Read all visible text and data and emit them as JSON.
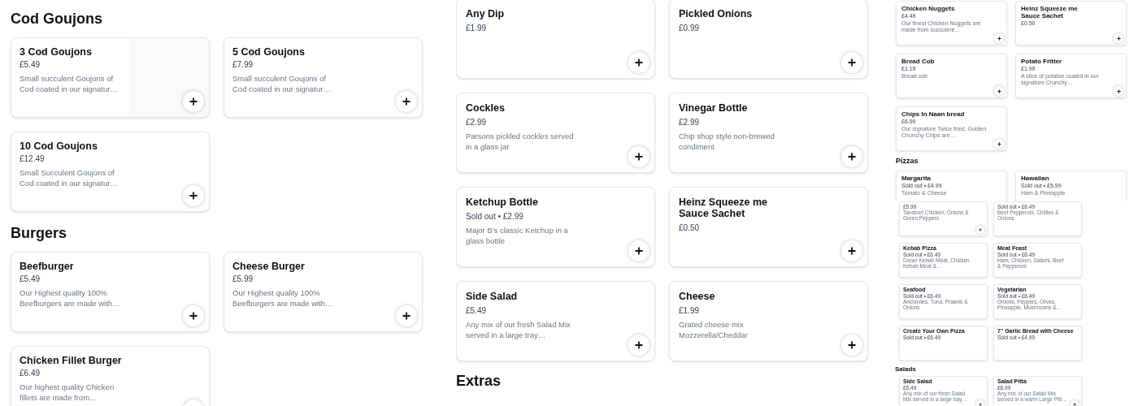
{
  "panels": [
    {
      "kind": "large",
      "sections": [
        {
          "heading": "Cod Goujons",
          "items": [
            {
              "name": "3 Cod Goujons",
              "price": "£5.49",
              "description": "Small succulent Goujons of Cod coated in our signatur…",
              "image": true,
              "add_button": true
            },
            {
              "name": "5 Cod Goujons",
              "price": "£7.99",
              "description": "Small succulent Goujons of Cod coated in our signatur…",
              "add_button": true
            },
            {
              "name": "10 Cod Goujons",
              "price": "£12.49",
              "description": "Small Succulent Goujons of Cod coated in our signatur…",
              "add_button": true
            }
          ]
        },
        {
          "heading": "Burgers",
          "items": [
            {
              "name": "Beefburger",
              "price": "£5.49",
              "description": "Our Highest quality 100% Beefburgers are made with…",
              "add_button": true
            },
            {
              "name": "Cheese Burger",
              "price": "£5.99",
              "description": "Our Highest quality 100% Beefburgers are made with…",
              "add_button": true
            },
            {
              "name": "Chicken Fillet Burger",
              "price": "£6.49",
              "description": "Our highest quality Chicken fillets are made from…",
              "add_button": true
            }
          ]
        }
      ]
    },
    {
      "kind": "large_cut",
      "sections": [
        {
          "items": [
            {
              "name": "Any Dip",
              "price": "£1.99",
              "add_button": true
            },
            {
              "name": "Pickled Onions",
              "price": "£0.99",
              "add_button": true
            },
            {
              "name": "Cockles",
              "price": "£2.99",
              "description": "Parsons pickled cockles served in a glass jar",
              "add_button": true
            },
            {
              "name": "Vinegar Bottle",
              "price": "£2.99",
              "description": "Chip shop style non-brewed condiment",
              "add_button": true
            },
            {
              "name": "Ketchup Bottle",
              "price": "Sold out • £2.99",
              "description": "Major B's classic Ketchup in a glass bottle",
              "add_button": true
            },
            {
              "name": "Heinz Squeeze me Sauce Sachet",
              "price": "£0.50",
              "add_button": true
            },
            {
              "name": "Side Salad",
              "price": "£5.49",
              "description": "Any mix of our fresh Salad Mix served in a large tray…",
              "add_button": true
            },
            {
              "name": "Cheese",
              "price": "£1.99",
              "description": "Grated cheese mix Mozzerella/Cheddar",
              "add_button": true
            }
          ]
        },
        {
          "heading": "Extras"
        }
      ]
    },
    {
      "kind": "medium",
      "sections": [
        {
          "items": [
            {
              "name": "Chicken Nuggets",
              "price": "£4.49",
              "description": "Our finest Chicken Nuggets are made from succulent…",
              "add_button": true
            },
            {
              "name": "Heinz Squeeze me Sauce Sachet",
              "price": "£0.50",
              "add_button": true
            },
            {
              "name": "Bread Cob",
              "price": "£1.19",
              "description": "Bread cob",
              "add_button": true
            },
            {
              "name": "Potato Fritter",
              "price": "£1.99",
              "description": "A slice of potatoe coated in our signature Crunchy…",
              "add_button": true
            },
            {
              "name": "Chips In Naan bread",
              "price": "£6.99",
              "description": "Our signature Twice fried, Golden Chunchy Chips are…",
              "add_button": true
            }
          ]
        },
        {
          "heading": "Pizzas",
          "items": [
            {
              "name": "Margarita",
              "price": "Sold out • £4.99",
              "description": "Tomato & Cheese",
              "add_button": false
            },
            {
              "name": "Hawaiian",
              "price": "Sold out • £5.99",
              "description": "Ham & Pineapple",
              "add_button": false
            }
          ]
        }
      ]
    },
    {
      "kind": "small",
      "sections": [
        {
          "items": [
            {
              "price": "£5.99",
              "description": "Tandoori Chicken, Onions & Green Peppers",
              "add_button": true
            },
            {
              "price": "Sold out • £6.49",
              "description": "Beef Pepperoni, Chillies & Onions",
              "add_button": false
            },
            {
              "name": "Kebab Pizza",
              "price": "Sold out • £6.49",
              "description": "Doner Kebab Meat, Chicken Kebab Meat &…",
              "add_button": false
            },
            {
              "name": "Meat Feast",
              "price": "Sold out • £6.49",
              "description": "Ham, Chicken, Salami, Beef & Pepperoni",
              "add_button": false
            },
            {
              "name": "Seafood",
              "price": "Sold out • £6.49",
              "description": "Anchovies, Tuna, Prawns & Onions",
              "add_button": false
            },
            {
              "name": "Vegetarian",
              "price": "Sold out • £6.49",
              "description": "Onions, Peppers, Olives, Pineapple, Mushrooms &…",
              "add_button": false
            },
            {
              "name": "Create Your Own Pizza",
              "price": "Sold out • £6.49",
              "add_button": false
            },
            {
              "name": "7\" Garlic Bread with Cheese",
              "price": "Sold out • £4.99",
              "add_button": false
            }
          ]
        },
        {
          "heading": "Salads",
          "items": [
            {
              "name": "Side Salad",
              "price": "£5.49",
              "description": "Any mix of our fresh Salad Mix served in a large tray…",
              "add_button": true
            },
            {
              "name": "Salad Pitta",
              "price": "£6.99",
              "description": "Any mix of our Salad Mix served in a warm Large Pitt…",
              "add_button": true
            }
          ]
        }
      ]
    }
  ]
}
